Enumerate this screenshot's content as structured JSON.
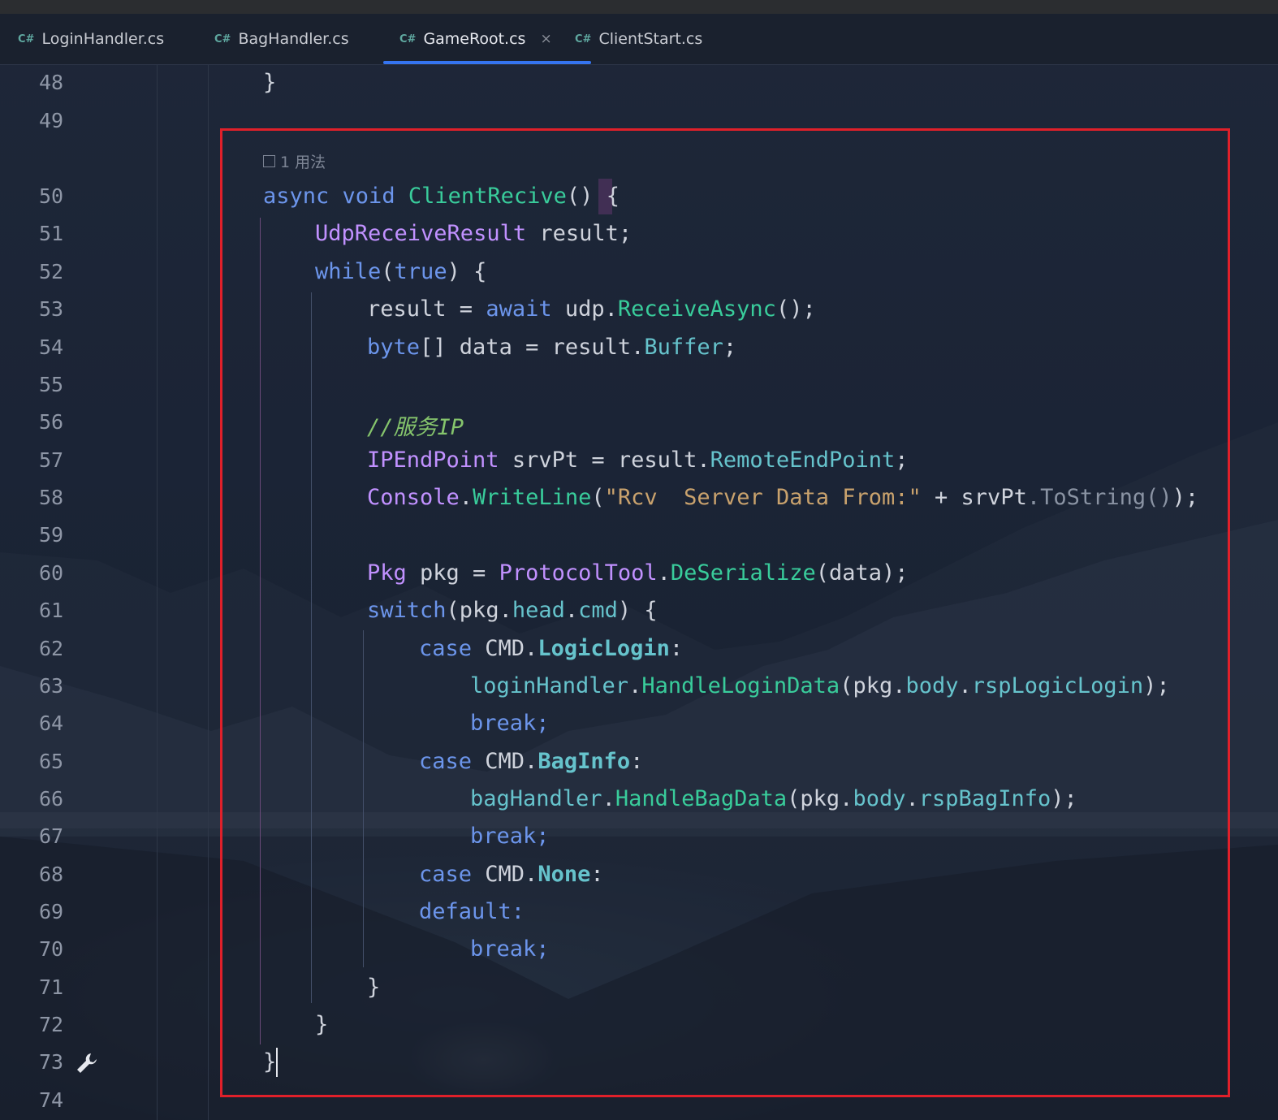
{
  "tabs": [
    {
      "lang": "C#",
      "label": "LoginHandler.cs",
      "active": false
    },
    {
      "lang": "C#",
      "label": "BagHandler.cs",
      "active": false
    },
    {
      "lang": "C#",
      "label": "GameRoot.cs",
      "active": true,
      "close": "×"
    },
    {
      "lang": "C#",
      "label": "ClientStart.cs",
      "active": false
    }
  ],
  "line_numbers": [
    "48",
    "49",
    "50",
    "51",
    "52",
    "53",
    "54",
    "55",
    "56",
    "57",
    "58",
    "59",
    "60",
    "61",
    "62",
    "63",
    "64",
    "65",
    "66",
    "67",
    "68",
    "69",
    "70",
    "71",
    "72",
    "73",
    "74"
  ],
  "usage_hint": "1 用法",
  "code": {
    "l48_brace": "}",
    "l50": {
      "async": "async",
      "void": "void",
      "name": "ClientRecive",
      "rest": "() {"
    },
    "l51": {
      "type": "UdpReceiveResult",
      "var": "result",
      "semi": ";"
    },
    "l52": {
      "while": "while",
      "open": "(",
      "true": "true",
      "rest": ") {"
    },
    "l53": {
      "a": "result = ",
      "await": "await",
      "b": " udp.",
      "fn": "ReceiveAsync",
      "c": "();"
    },
    "l54": {
      "byte": "byte",
      "a": "[] data = result.",
      "mem": "Buffer",
      "b": ";"
    },
    "l56": "//服务IP",
    "l57": {
      "type": "IPEndPoint",
      "a": " srvPt = result.",
      "mem": "RemoteEndPoint",
      "b": ";"
    },
    "l58": {
      "type": "Console",
      "dot": ".",
      "fn": "WriteLine",
      "open": "(",
      "str": "\"Rcv  Server Data From:\"",
      "a": " + srvPt",
      "dim": ".ToString()",
      "b": ");"
    },
    "l60": {
      "type": "Pkg",
      "a": " pkg = ",
      "type2": "ProtocolTool",
      "dot": ".",
      "fn": "DeSerialize",
      "b": "(data);"
    },
    "l61": {
      "switch": "switch",
      "a": "(pkg.",
      "m1": "head",
      "dot": ".",
      "m2": "cmd",
      "b": ") {"
    },
    "l62": {
      "case": "case",
      "a": " CMD.",
      "en": "LogicLogin",
      "b": ":"
    },
    "l63": {
      "a": "loginHandler",
      "dot": ".",
      "fn": "HandleLoginData",
      "b": "(pkg.",
      "m1": "body",
      "dot2": ".",
      "m2": "rspLogicLogin",
      "c": ");"
    },
    "l64": "break;",
    "l65": {
      "case": "case",
      "a": " CMD.",
      "en": "BagInfo",
      "b": ":"
    },
    "l66": {
      "a": "bagHandler",
      "dot": ".",
      "fn": "HandleBagData",
      "b": "(pkg.",
      "m1": "body",
      "dot2": ".",
      "m2": "rspBagInfo",
      "c": ");"
    },
    "l67": "break;",
    "l68": {
      "case": "case",
      "a": " CMD.",
      "en": "None",
      "b": ":"
    },
    "l69": "default:",
    "l70": "break;",
    "l71": "}",
    "l72": "}",
    "l73": "}"
  },
  "colors": {
    "keyword": "#6c95eb",
    "type": "#c191ff",
    "method": "#39cc9b",
    "member": "#66c3cc",
    "string": "#c9a26d",
    "comment": "#85c46c",
    "highlight_box": "#e0202a",
    "active_tab_underline": "#3574f0"
  },
  "icons": [
    "csharp-file-icon",
    "close-icon",
    "wrench-icon",
    "usage-link-icon"
  ]
}
